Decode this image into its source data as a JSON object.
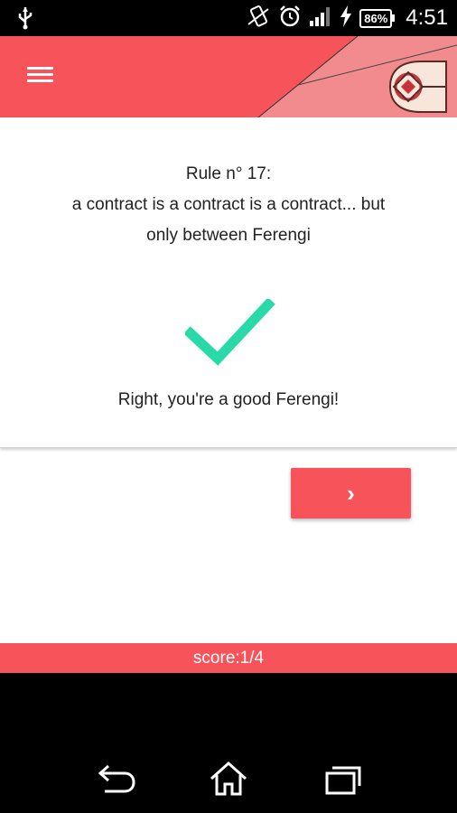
{
  "status_bar": {
    "battery": "86%",
    "time": "4:51",
    "icons": [
      "usb-icon",
      "vibrate-icon",
      "alarm-icon",
      "signal-icon",
      "charging-icon",
      "battery-icon"
    ]
  },
  "app_bar": {
    "menu_icon": "hamburger-menu-icon",
    "logo_icon": "ferengi-logo-icon"
  },
  "question": {
    "rule_title": "Rule n° 17:",
    "rule_text_line1": "a contract is a contract is a contract... but",
    "rule_text_line2": "only between Ferengi"
  },
  "result": {
    "icon": "checkmark-icon",
    "message": "Right, you're a good Ferengi!"
  },
  "next_button": {
    "label": "›"
  },
  "score": {
    "label": "score:1/4"
  },
  "nav_bar": {
    "icons": [
      "back-icon",
      "home-icon",
      "recent-apps-icon"
    ]
  },
  "colors": {
    "accent": "#f6535a",
    "accent_light": "#f28b8e",
    "check": "#29d9a8"
  }
}
